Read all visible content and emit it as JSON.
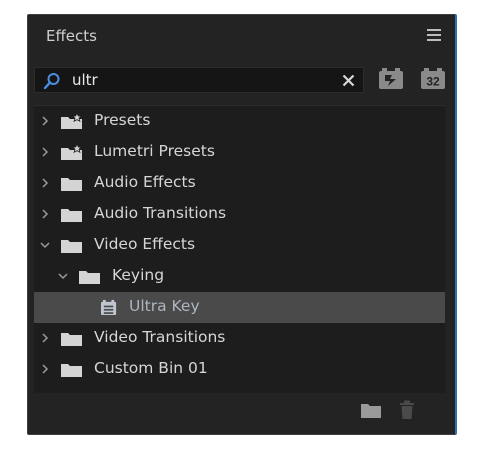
{
  "panel": {
    "title": "Effects"
  },
  "search": {
    "value": "ultr"
  },
  "toolbar": {
    "yuv_label": "32"
  },
  "tree": [
    {
      "label": "Presets",
      "depth": 0,
      "expanded": false,
      "kind": "preset-bin"
    },
    {
      "label": "Lumetri Presets",
      "depth": 0,
      "expanded": false,
      "kind": "preset-bin"
    },
    {
      "label": "Audio Effects",
      "depth": 0,
      "expanded": false,
      "kind": "bin"
    },
    {
      "label": "Audio Transitions",
      "depth": 0,
      "expanded": false,
      "kind": "bin"
    },
    {
      "label": "Video Effects",
      "depth": 0,
      "expanded": true,
      "kind": "bin"
    },
    {
      "label": "Keying",
      "depth": 1,
      "expanded": true,
      "kind": "bin"
    },
    {
      "label": "Ultra Key",
      "depth": 2,
      "selected": true,
      "kind": "effect"
    },
    {
      "label": "Video Transitions",
      "depth": 0,
      "expanded": false,
      "kind": "bin"
    },
    {
      "label": "Custom Bin 01",
      "depth": 0,
      "expanded": false,
      "kind": "bin"
    }
  ],
  "colors": {
    "panel_bg": "#232323",
    "list_bg": "#1d1d1d",
    "selected_row": "#4a4a4a",
    "focus_border": "#2f6fb5",
    "search_icon": "#4a90e2"
  }
}
